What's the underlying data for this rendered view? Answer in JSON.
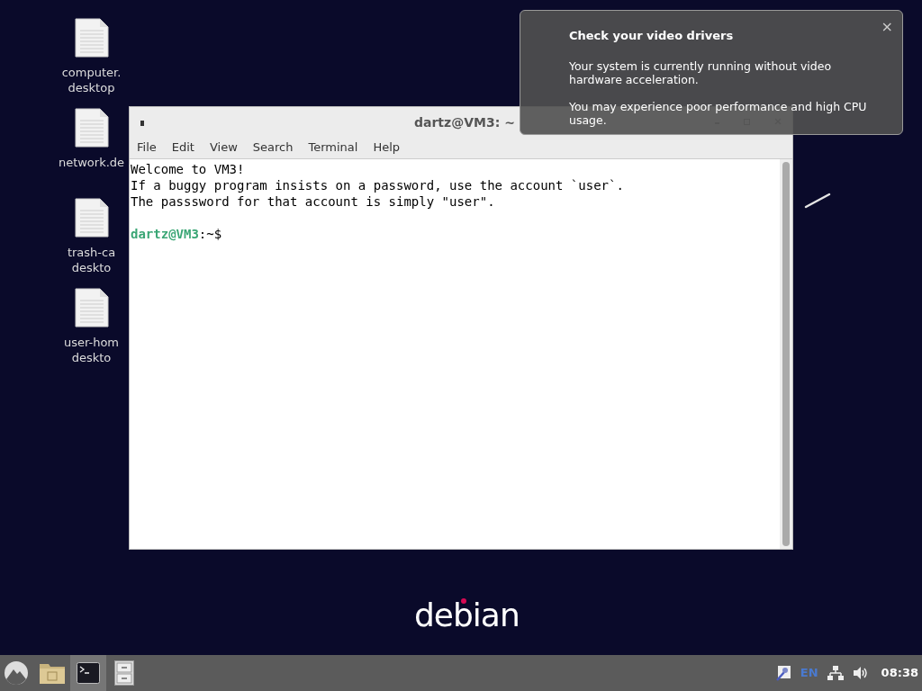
{
  "desktop_icons": [
    {
      "lines": [
        "computer.",
        "desktop"
      ]
    },
    {
      "lines": [
        "network.de"
      ]
    },
    {
      "lines": [
        "trash-ca",
        "deskto"
      ]
    },
    {
      "lines": [
        "user-hom",
        "deskto"
      ]
    }
  ],
  "terminal": {
    "title": "dartz@VM3: ~",
    "menu": [
      "File",
      "Edit",
      "View",
      "Search",
      "Terminal",
      "Help"
    ],
    "output": [
      "Welcome to VM3!",
      "If a buggy program insists on a password, use the account `user`.",
      "The passsword for that account is simply \"user\"."
    ],
    "prompt": {
      "user_host": "dartz@VM3",
      "path": ":~$"
    }
  },
  "notification": {
    "title": "Check your video drivers",
    "paragraphs": [
      "Your system is currently running without video hardware acceleration.",
      "You may experience poor performance and high CPU usage."
    ],
    "close": "×"
  },
  "wallpaper_logo": "debian",
  "taskbar": {
    "apps": [
      {
        "kind": "menu",
        "selected": false
      },
      {
        "kind": "folder",
        "selected": false
      },
      {
        "kind": "terminal",
        "selected": true
      },
      {
        "kind": "cabinet",
        "selected": false
      }
    ],
    "keyboard_layout": "EN",
    "clock": "08:38"
  }
}
